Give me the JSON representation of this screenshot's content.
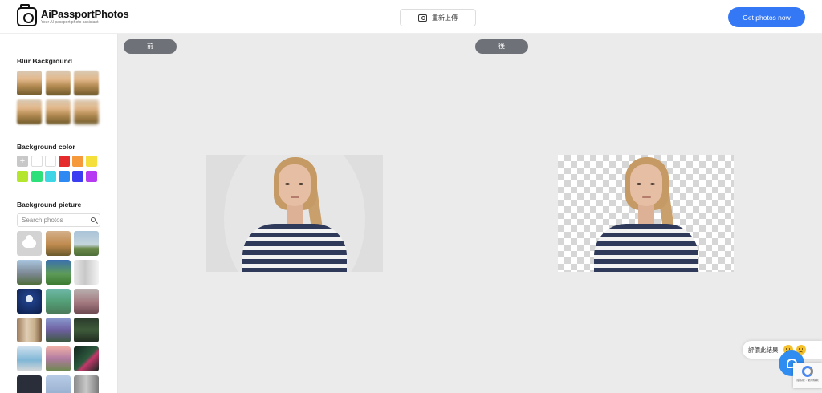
{
  "header": {
    "app_title": "AiPassportPhotos",
    "app_subtitle": "Your AI passport photo assistant",
    "reupload_label": "重新上傳",
    "cta_label": "Get photos now"
  },
  "sidebar": {
    "blur_title": "Blur Background",
    "color_title": "Background color",
    "colors": [
      "#ffffff",
      "#ffffff",
      "#e52b2b",
      "#f6993a",
      "#f5e03b",
      "#b5e62e",
      "#2ee07a",
      "#3ed6e6",
      "#2f89f2",
      "#3a3ef0",
      "#b63af2"
    ],
    "color_add_label": "+",
    "picture_title": "Background picture",
    "search": {
      "placeholder": "Search photos"
    }
  },
  "workspace": {
    "left_pill_label": "前",
    "right_pill_label": "後"
  },
  "feedback": {
    "label": "評價此結果:"
  },
  "recaptcha": {
    "text": "隱私權 - 使用條款"
  }
}
